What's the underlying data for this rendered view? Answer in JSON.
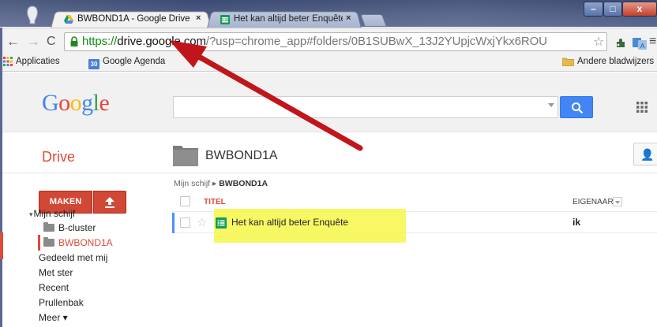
{
  "window": {
    "minimize_label": "–",
    "maximize_label": "□",
    "close_label": "x"
  },
  "tabs": [
    {
      "title": "BWBOND1A - Google Drive",
      "close": "×",
      "icon": "google-drive-icon"
    },
    {
      "title": "Het kan altijd beter Enquête",
      "close": "×",
      "icon": "google-sheets-icon"
    }
  ],
  "toolbar": {
    "url_scheme": "https://",
    "url_host": "drive.google.com",
    "url_rest": "/?usp=chrome_app#folders/0B1SUBwX_13J2YUpjcWxjYkx6ROU",
    "back": "←",
    "forward": "→",
    "reload": "C",
    "star": "☆",
    "menu": "≡"
  },
  "bookmarks": {
    "apps_label": "Applicaties",
    "agenda_badge": "30",
    "agenda_label": "Google Agenda",
    "other_label": "Andere bladwijzers"
  },
  "header": {
    "logo_letters": [
      "G",
      "o",
      "o",
      "g",
      "l",
      "e"
    ],
    "logo_colors": [
      "#4285f4",
      "#ea4335",
      "#fbbc05",
      "#4285f4",
      "#34a853",
      "#ea4335"
    ]
  },
  "drive": {
    "label": "Drive",
    "folder_title": "BWBOND1A",
    "create_label": "MAKEN",
    "breadcrumb_root": "Mijn schijf",
    "breadcrumb_sep": "▸",
    "breadcrumb_current": "BWBOND1A",
    "nav": {
      "my_drive": "Mijn schijf",
      "caret": "▾",
      "bcluster": "B-cluster",
      "bwbond": "BWBOND1A",
      "shared": "Gedeeld met mij",
      "starred": "Met ster",
      "recent": "Recent",
      "trash": "Prullenbak",
      "more": "Meer ▾"
    },
    "table": {
      "col_title": "TITEL",
      "col_owner": "EIGENAAR",
      "rows": [
        {
          "name": "Het kan altijd beter Enquête",
          "owner": "ik",
          "star": "☆"
        }
      ]
    }
  },
  "colors": {
    "accent_red": "#dd4b39",
    "search_blue": "#4285f4",
    "highlight_yellow": "#f7f74a",
    "arrow_red": "#c0161b"
  }
}
